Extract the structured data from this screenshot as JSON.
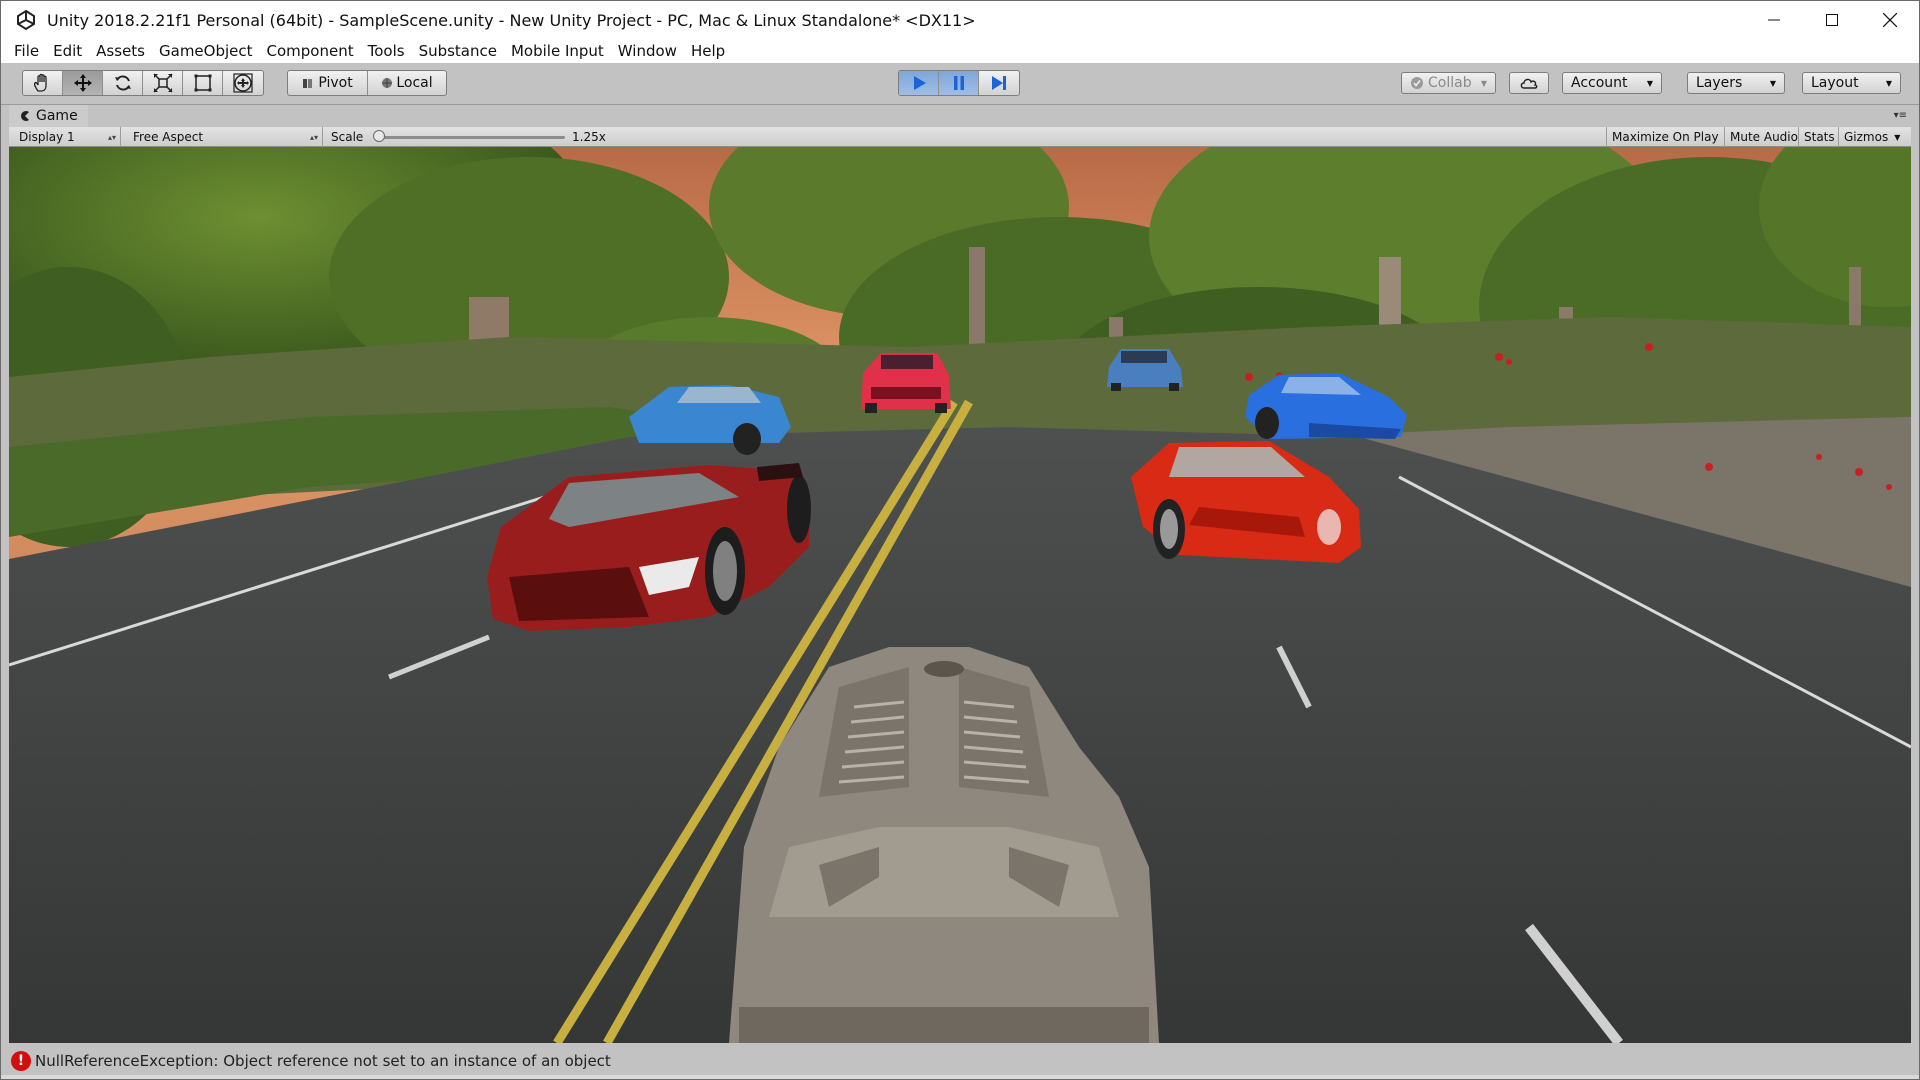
{
  "window": {
    "title": "Unity 2018.2.21f1 Personal (64bit) - SampleScene.unity - New Unity Project - PC, Mac & Linux Standalone* <DX11>",
    "controls": [
      "minimize-icon",
      "maximize-icon",
      "close-icon"
    ]
  },
  "menu": [
    "File",
    "Edit",
    "Assets",
    "GameObject",
    "Component",
    "Tools",
    "Substance",
    "Mobile Input",
    "Window",
    "Help"
  ],
  "toolbar": {
    "tools": [
      "hand-tool-icon",
      "move-tool-icon",
      "rotate-tool-icon",
      "scale-tool-icon",
      "rect-tool-icon",
      "transform-tool-icon"
    ],
    "active_tool": "move-tool-icon",
    "pivot_label": "Pivot",
    "local_label": "Local",
    "play_controls": [
      "play-icon",
      "pause-icon",
      "step-icon"
    ],
    "collab_label": "Collab",
    "account_label": "Account",
    "layers_label": "Layers",
    "layout_label": "Layout",
    "accent_color": "#1a63d8"
  },
  "game_tab": {
    "label": "Game"
  },
  "game_bar": {
    "display": "Display 1",
    "aspect": "Free Aspect",
    "scale_label": "Scale",
    "scale_value": "1.25x",
    "scale_fraction": 0.02,
    "buttons": [
      "Maximize On Play",
      "Mute Audio",
      "Stats",
      "Gizmos"
    ]
  },
  "status": {
    "error_color": "#d20f0f",
    "message": "NullReferenceException: Object reference not set to an instance of an object"
  },
  "scene": {
    "sky_color": "#d68a5c",
    "road_color": "#3d3f3f",
    "cars": [
      {
        "name": "red-sports-car",
        "color": "#9a1d1d"
      },
      {
        "name": "blue-coupe",
        "color": "#3a86d0"
      },
      {
        "name": "pink-sedan",
        "color": "#e0304a"
      },
      {
        "name": "blue-hatchback",
        "color": "#4a7fbf"
      },
      {
        "name": "blue-gt-car",
        "color": "#2a6fe0"
      },
      {
        "name": "orange-red-supercar",
        "color": "#d82a14"
      },
      {
        "name": "player-car-grey",
        "color": "#8e887e"
      }
    ]
  }
}
